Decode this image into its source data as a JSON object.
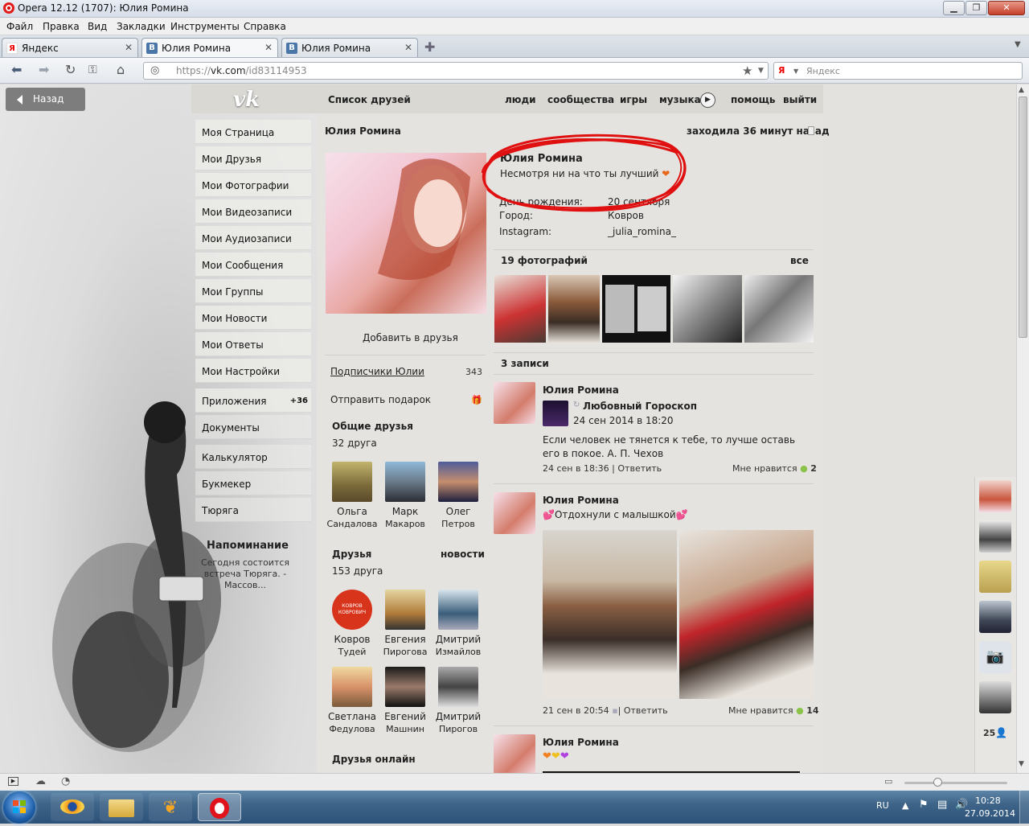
{
  "window": {
    "title": "Opera 12.12 (1707): Юлия Ромина"
  },
  "menu": [
    "Файл",
    "Правка",
    "Вид",
    "Закладки",
    "Инструменты",
    "Справка"
  ],
  "tabs": [
    {
      "label": "Яндекс",
      "fav": "Я"
    },
    {
      "label": "Юлия Ромина",
      "fav": "В"
    },
    {
      "label": "Юлия Ромина",
      "fav": "В"
    }
  ],
  "address": {
    "scheme": "https://",
    "host": "vk.com",
    "path": "/id83114953"
  },
  "search": {
    "placeholder": "Яндекс",
    "engine": "Я"
  },
  "back_label": "Назад",
  "vk": {
    "logo": "vk",
    "friends_list": "Список друзей",
    "nav": [
      "люди",
      "сообщества",
      "игры",
      "музыка",
      "помощь",
      "выйти"
    ]
  },
  "left_menu": [
    "Моя Страница",
    "Мои Друзья",
    "Мои Фотографии",
    "Мои Видеозаписи",
    "Мои Аудиозаписи",
    "Мои Сообщения",
    "Мои Группы",
    "Мои Новости",
    "Мои Ответы",
    "Мои Настройки"
  ],
  "apps": {
    "label": "Приложения",
    "count": "+36"
  },
  "app_items": [
    "Документы",
    "Калькулятор",
    "Букмекер",
    "Тюряга"
  ],
  "reminder": {
    "title": "Напоминание",
    "text": "Сегодня состоится встреча Тюряга. - Массов..."
  },
  "profile": {
    "header_name": "Юлия Ромина",
    "last_seen": "заходила 36 минут назад",
    "name": "Юлия Ромина",
    "status": "Несмотря ни на что ты лучший",
    "fields": [
      {
        "label": "День рождения:",
        "value": "20 сентября"
      },
      {
        "label": "Город:",
        "value": "Ковров"
      },
      {
        "label": "Instagram:",
        "value": "_julia_romina_"
      }
    ],
    "add_friend": "Добавить в друзья",
    "followers_label": "Подписчики Юлии",
    "followers_count": "343",
    "gift_label": "Отправить подарок"
  },
  "mutual": {
    "title": "Общие друзья",
    "count": "32 друга",
    "people": [
      {
        "first": "Ольга",
        "last": "Сандалова"
      },
      {
        "first": "Марк",
        "last": "Макаров"
      },
      {
        "first": "Олег",
        "last": "Петров"
      }
    ]
  },
  "friends": {
    "title": "Друзья",
    "news": "новости",
    "count": "153 друга",
    "people": [
      {
        "first": "Ковров",
        "last": "Тудей"
      },
      {
        "first": "Евгения",
        "last": "Пирогова"
      },
      {
        "first": "Дмитрий",
        "last": "Измайлов"
      },
      {
        "first": "Светлана",
        "last": "Федулова"
      },
      {
        "first": "Евгений",
        "last": "Машнин"
      },
      {
        "first": "Дмитрий",
        "last": "Пирогов"
      }
    ]
  },
  "friends_online": "Друзья онлайн",
  "kovrov_logo": "КОВРОВ КОВРОВИЧ",
  "photos": {
    "title": "19 фотографий",
    "all": "все"
  },
  "wall": {
    "title": "3 записи",
    "posts": [
      {
        "author": "Юлия Ромина",
        "repost_from": "Любовный Гороскоп",
        "repost_date": "24 сен 2014 в 18:20",
        "text": "Если человек не тянется к тебе, то лучше оставь его в покое. А. П. Чехов",
        "date": "24 сен в 18:36",
        "reply": "Ответить",
        "likes_label": "Мне нравится",
        "likes": "2"
      },
      {
        "author": "Юлия Ромина",
        "text": "Отдохнули с малышкой",
        "date": "21 сен в 20:54",
        "reply": "Ответить",
        "likes_label": "Мне нравится",
        "likes": "14"
      },
      {
        "author": "Юлия Ромина"
      }
    ]
  },
  "right_bar": {
    "count": "25"
  },
  "taskbar": {
    "lang": "RU",
    "time": "10:28",
    "date": "27.09.2014"
  },
  "colors": {
    "vk_bg": "#e4e3df",
    "like_dot": "#8bc34a",
    "annotation": "#e01010"
  }
}
